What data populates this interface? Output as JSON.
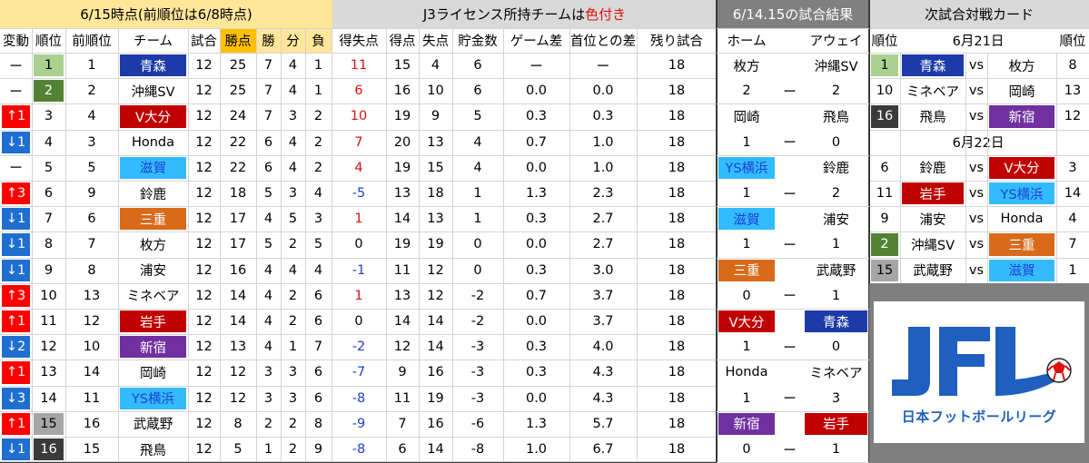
{
  "header": {
    "left_title": "6/15時点(前順位は6/8時点)",
    "mid_title_plain": "J3ライセンス所持チームは",
    "mid_title_red": "色付き",
    "results_title": "6/14.15の試合結果",
    "next_title": "次試合対戦カード"
  },
  "columns": {
    "change": "変動",
    "rank": "順位",
    "prev_rank": "前順位",
    "team": "チーム",
    "played": "試合",
    "points": "勝点",
    "win": "勝",
    "draw": "分",
    "loss": "負",
    "gd": "得失点",
    "gf": "得点",
    "ga": "失点",
    "savings": "貯金数",
    "games_behind": "ゲーム差",
    "gap_to_top": "首位との差",
    "remaining": "残り試合",
    "home": "ホーム",
    "away": "アウェイ",
    "next_rank_left": "順位",
    "next_rank_right": "順位"
  },
  "colors": {
    "header_yellow": "#ffe699",
    "header_gray": "#d9d9d9",
    "header_dark": "#808080",
    "rank_green_light": "#a9d08e",
    "rank_green_dark": "#548235",
    "rank_gray": "#a6a6a6",
    "rank_black": "#3a3a3a",
    "up_red": "#ff0000",
    "down_blue": "#1f6fd0",
    "team_navy": "#1c3aa8",
    "team_darkred": "#c00000",
    "team_skyblue": "#33bbff",
    "team_orange": "#d86a1a",
    "team_purple": "#7030a0",
    "points_orange": "#ffc000"
  },
  "standings": [
    {
      "change": "ー",
      "change_dir": "none",
      "rank": "1",
      "prev": "1",
      "team": "青森",
      "team_color": "navy",
      "played": "12",
      "pts": "25",
      "w": "7",
      "d": "4",
      "l": "1",
      "gd": "11",
      "gf": "15",
      "ga": "4",
      "sav": "6",
      "gb": "ー",
      "gap": "ー",
      "rem": "18",
      "rank_style": "green_light"
    },
    {
      "change": "ー",
      "change_dir": "none",
      "rank": "2",
      "prev": "2",
      "team": "沖縄SV",
      "team_color": "",
      "played": "12",
      "pts": "25",
      "w": "7",
      "d": "4",
      "l": "1",
      "gd": "6",
      "gf": "16",
      "ga": "10",
      "sav": "6",
      "gb": "0.0",
      "gap": "0.0",
      "rem": "18",
      "rank_style": "green_dark"
    },
    {
      "change": "↑1",
      "change_dir": "up",
      "rank": "3",
      "prev": "4",
      "team": "V大分",
      "team_color": "darkred",
      "played": "12",
      "pts": "24",
      "w": "7",
      "d": "3",
      "l": "2",
      "gd": "10",
      "gf": "19",
      "ga": "9",
      "sav": "5",
      "gb": "0.3",
      "gap": "0.3",
      "rem": "18",
      "rank_style": ""
    },
    {
      "change": "↓1",
      "change_dir": "down",
      "rank": "4",
      "prev": "3",
      "team": "Honda",
      "team_color": "",
      "played": "12",
      "pts": "22",
      "w": "6",
      "d": "4",
      "l": "2",
      "gd": "7",
      "gf": "20",
      "ga": "13",
      "sav": "4",
      "gb": "0.7",
      "gap": "1.0",
      "rem": "18",
      "rank_style": ""
    },
    {
      "change": "ー",
      "change_dir": "none",
      "rank": "5",
      "prev": "5",
      "team": "滋賀",
      "team_color": "skyblue",
      "played": "12",
      "pts": "22",
      "w": "6",
      "d": "4",
      "l": "2",
      "gd": "4",
      "gf": "19",
      "ga": "15",
      "sav": "4",
      "gb": "0.0",
      "gap": "1.0",
      "rem": "18",
      "rank_style": ""
    },
    {
      "change": "↑3",
      "change_dir": "up",
      "rank": "6",
      "prev": "9",
      "team": "鈴鹿",
      "team_color": "",
      "played": "12",
      "pts": "18",
      "w": "5",
      "d": "3",
      "l": "4",
      "gd": "-5",
      "gf": "13",
      "ga": "18",
      "sav": "1",
      "gb": "1.3",
      "gap": "2.3",
      "rem": "18",
      "rank_style": ""
    },
    {
      "change": "↓1",
      "change_dir": "down",
      "rank": "7",
      "prev": "6",
      "team": "三重",
      "team_color": "orange",
      "played": "12",
      "pts": "17",
      "w": "4",
      "d": "5",
      "l": "3",
      "gd": "1",
      "gf": "14",
      "ga": "13",
      "sav": "1",
      "gb": "0.3",
      "gap": "2.7",
      "rem": "18",
      "rank_style": ""
    },
    {
      "change": "↓1",
      "change_dir": "down",
      "rank": "8",
      "prev": "7",
      "team": "枚方",
      "team_color": "",
      "played": "12",
      "pts": "17",
      "w": "5",
      "d": "2",
      "l": "5",
      "gd": "0",
      "gf": "19",
      "ga": "19",
      "sav": "0",
      "gb": "0.0",
      "gap": "2.7",
      "rem": "18",
      "rank_style": ""
    },
    {
      "change": "↓1",
      "change_dir": "down",
      "rank": "9",
      "prev": "8",
      "team": "浦安",
      "team_color": "",
      "played": "12",
      "pts": "16",
      "w": "4",
      "d": "4",
      "l": "4",
      "gd": "-1",
      "gf": "11",
      "ga": "12",
      "sav": "0",
      "gb": "0.3",
      "gap": "3.0",
      "rem": "18",
      "rank_style": ""
    },
    {
      "change": "↑3",
      "change_dir": "up",
      "rank": "10",
      "prev": "13",
      "team": "ミネベア",
      "team_color": "",
      "played": "12",
      "pts": "14",
      "w": "4",
      "d": "2",
      "l": "6",
      "gd": "1",
      "gf": "13",
      "ga": "12",
      "sav": "-2",
      "gb": "0.7",
      "gap": "3.7",
      "rem": "18",
      "rank_style": ""
    },
    {
      "change": "↑1",
      "change_dir": "up",
      "rank": "11",
      "prev": "12",
      "team": "岩手",
      "team_color": "darkred",
      "played": "12",
      "pts": "14",
      "w": "4",
      "d": "2",
      "l": "6",
      "gd": "0",
      "gf": "14",
      "ga": "14",
      "sav": "-2",
      "gb": "0.0",
      "gap": "3.7",
      "rem": "18",
      "rank_style": ""
    },
    {
      "change": "↓2",
      "change_dir": "down",
      "rank": "12",
      "prev": "10",
      "team": "新宿",
      "team_color": "purple",
      "played": "12",
      "pts": "13",
      "w": "4",
      "d": "1",
      "l": "7",
      "gd": "-2",
      "gf": "12",
      "ga": "14",
      "sav": "-3",
      "gb": "0.3",
      "gap": "4.0",
      "rem": "18",
      "rank_style": ""
    },
    {
      "change": "↑1",
      "change_dir": "up",
      "rank": "13",
      "prev": "14",
      "team": "岡崎",
      "team_color": "",
      "played": "12",
      "pts": "12",
      "w": "3",
      "d": "3",
      "l": "6",
      "gd": "-7",
      "gf": "9",
      "ga": "16",
      "sav": "-3",
      "gb": "0.3",
      "gap": "4.3",
      "rem": "18",
      "rank_style": ""
    },
    {
      "change": "↓3",
      "change_dir": "down",
      "rank": "14",
      "prev": "11",
      "team": "YS横浜",
      "team_color": "skyblue",
      "played": "12",
      "pts": "12",
      "w": "3",
      "d": "3",
      "l": "6",
      "gd": "-8",
      "gf": "11",
      "ga": "19",
      "sav": "-3",
      "gb": "0.0",
      "gap": "4.3",
      "rem": "18",
      "rank_style": ""
    },
    {
      "change": "↑1",
      "change_dir": "up",
      "rank": "15",
      "prev": "16",
      "team": "武蔵野",
      "team_color": "",
      "played": "12",
      "pts": "8",
      "w": "2",
      "d": "2",
      "l": "8",
      "gd": "-9",
      "gf": "7",
      "ga": "16",
      "sav": "-6",
      "gb": "1.3",
      "gap": "5.7",
      "rem": "18",
      "rank_style": "gray"
    },
    {
      "change": "↓1",
      "change_dir": "down",
      "rank": "16",
      "prev": "15",
      "team": "飛鳥",
      "team_color": "",
      "played": "12",
      "pts": "5",
      "w": "1",
      "d": "2",
      "l": "9",
      "gd": "-8",
      "gf": "6",
      "ga": "14",
      "sav": "-8",
      "gb": "1.0",
      "gap": "6.7",
      "rem": "18",
      "rank_style": "black"
    }
  ],
  "results": [
    {
      "home": "枚方",
      "home_color": "",
      "away": "沖縄SV",
      "away_color": "",
      "hs": "2",
      "sep": "ー",
      "as": "2"
    },
    {
      "home": "岡崎",
      "home_color": "",
      "away": "飛鳥",
      "away_color": "",
      "hs": "1",
      "sep": "ー",
      "as": "0"
    },
    {
      "home": "YS横浜",
      "home_color": "skyblue",
      "away": "鈴鹿",
      "away_color": "",
      "hs": "1",
      "sep": "ー",
      "as": "2"
    },
    {
      "home": "滋賀",
      "home_color": "skyblue",
      "away": "浦安",
      "away_color": "",
      "hs": "1",
      "sep": "ー",
      "as": "1"
    },
    {
      "home": "三重",
      "home_color": "orange",
      "away": "武蔵野",
      "away_color": "",
      "hs": "0",
      "sep": "ー",
      "as": "1"
    },
    {
      "home": "V大分",
      "home_color": "darkred",
      "away": "青森",
      "away_color": "navy",
      "hs": "1",
      "sep": "ー",
      "as": "0"
    },
    {
      "home": "Honda",
      "home_color": "",
      "away": "ミネベア",
      "away_color": "",
      "hs": "1",
      "sep": "ー",
      "as": "3"
    },
    {
      "home": "新宿",
      "home_color": "purple",
      "away": "岩手",
      "away_color": "darkred",
      "hs": "0",
      "sep": "ー",
      "as": "1"
    }
  ],
  "next": {
    "date1": "6月21日",
    "date2": "6月22日",
    "vs": "vs",
    "day1": [
      {
        "lr": "1",
        "lr_style": "green_light",
        "home": "青森",
        "home_color": "navy",
        "away": "枚方",
        "away_color": "",
        "rr": "8"
      },
      {
        "lr": "10",
        "lr_style": "",
        "home": "ミネベア",
        "home_color": "",
        "away": "岡崎",
        "away_color": "",
        "rr": "13"
      },
      {
        "lr": "16",
        "lr_style": "black",
        "home": "飛鳥",
        "home_color": "",
        "away": "新宿",
        "away_color": "purple",
        "rr": "12"
      }
    ],
    "day2": [
      {
        "lr": "6",
        "lr_style": "",
        "home": "鈴鹿",
        "home_color": "",
        "away": "V大分",
        "away_color": "darkred",
        "rr": "3"
      },
      {
        "lr": "11",
        "lr_style": "",
        "home": "岩手",
        "home_color": "darkred",
        "away": "YS横浜",
        "away_color": "skyblue",
        "rr": "14"
      },
      {
        "lr": "9",
        "lr_style": "",
        "home": "浦安",
        "home_color": "",
        "away": "Honda",
        "away_color": "",
        "rr": "4"
      },
      {
        "lr": "2",
        "lr_style": "green_dark",
        "home": "沖縄SV",
        "home_color": "",
        "away": "三重",
        "away_color": "orange",
        "rr": "7"
      },
      {
        "lr": "15",
        "lr_style": "gray",
        "home": "武蔵野",
        "home_color": "",
        "away": "滋賀",
        "away_color": "skyblue",
        "rr": "1"
      }
    ]
  },
  "logo": {
    "text": "JFL",
    "subtitle": "日本フットボールリーグ"
  }
}
